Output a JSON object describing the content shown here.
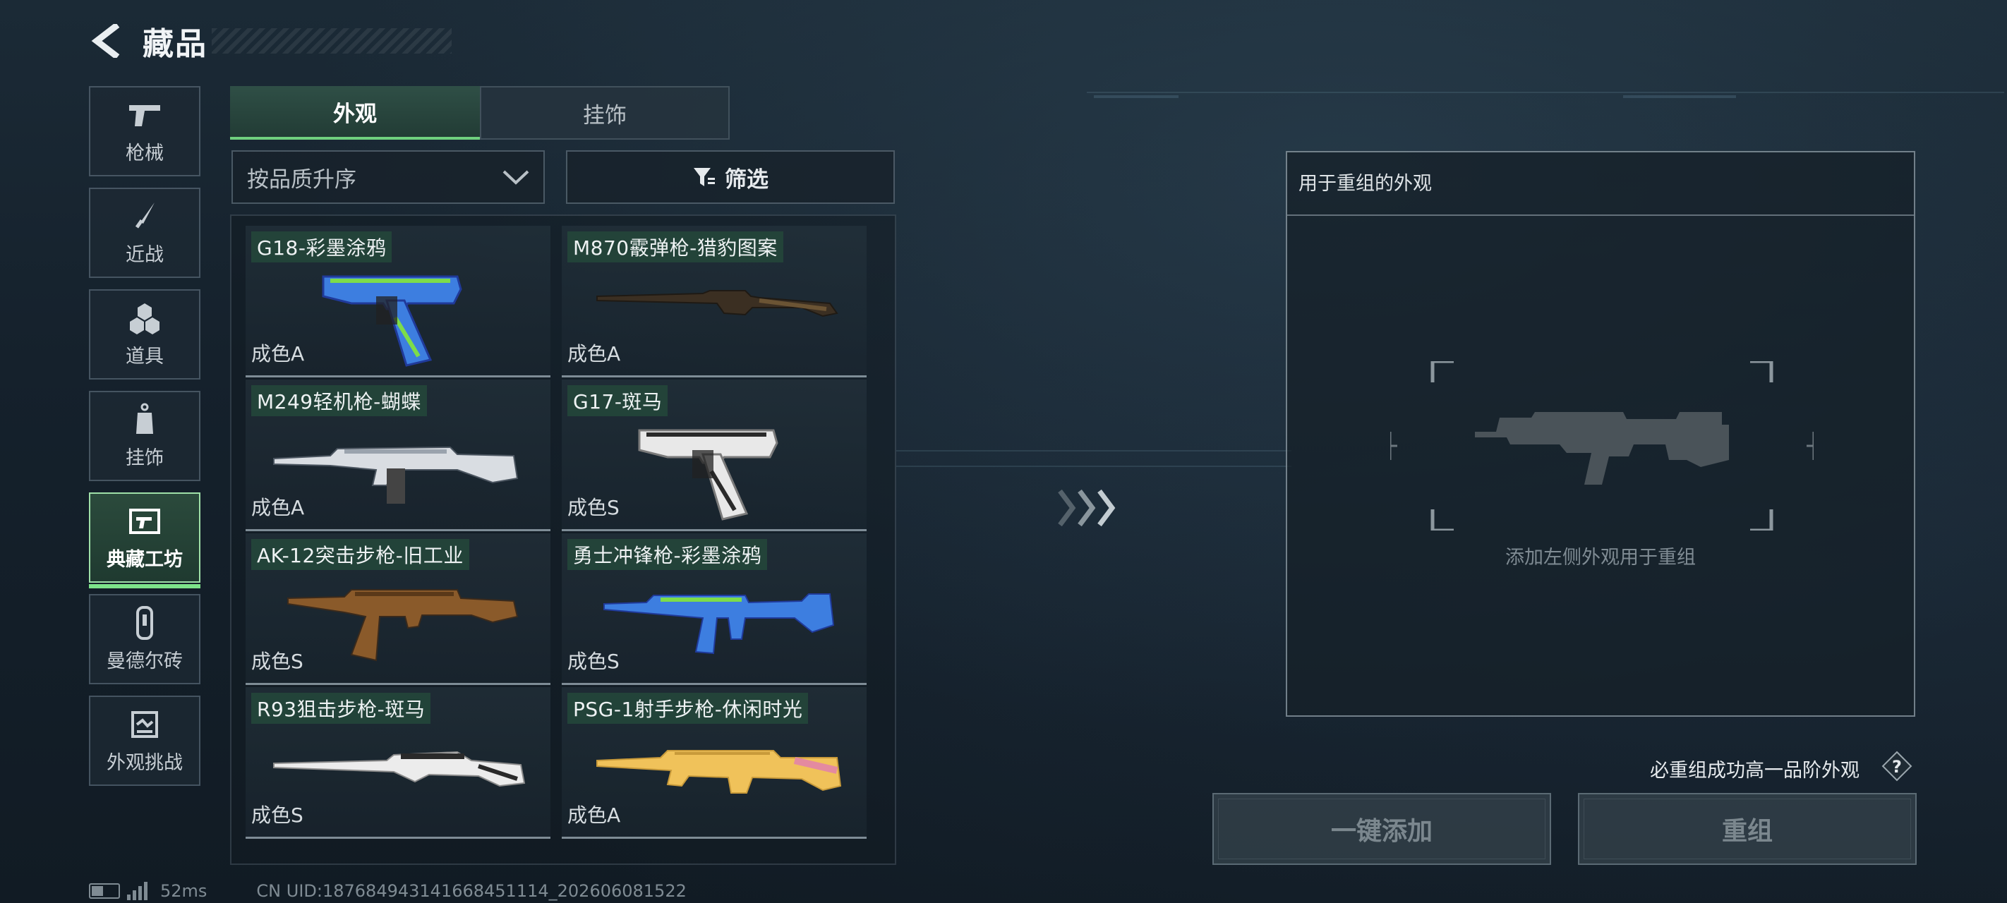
{
  "header": {
    "title": "藏品"
  },
  "nav": [
    {
      "label": "枪械",
      "icon": "pistol-icon",
      "active": false
    },
    {
      "label": "近战",
      "icon": "knife-icon",
      "active": false
    },
    {
      "label": "道具",
      "icon": "grenades-icon",
      "active": false
    },
    {
      "label": "挂饰",
      "icon": "charm-icon",
      "active": false
    },
    {
      "label": "典藏工坊",
      "icon": "workshop-icon",
      "active": true
    },
    {
      "label": "曼德尔砖",
      "icon": "mandel-brick-icon",
      "active": false
    },
    {
      "label": "外观挑战",
      "icon": "skin-challenge-icon",
      "active": false
    }
  ],
  "tabs": [
    {
      "label": "外观",
      "active": true
    },
    {
      "label": "挂饰",
      "active": false
    }
  ],
  "sort": {
    "label": "按品质升序"
  },
  "filter": {
    "label": "筛选"
  },
  "items": [
    {
      "name": "G18-彩墨涂鸦",
      "grade": "成色A",
      "weapon": "pistol",
      "colors": [
        "#3d7ee0",
        "#7ddc4a",
        "#203a9a"
      ]
    },
    {
      "name": "M870霰弹枪-猎豹图案",
      "grade": "成色A",
      "weapon": "shotgun",
      "colors": [
        "#3b2f22",
        "#6b5434",
        "#1f1a14"
      ]
    },
    {
      "name": "M249轻机枪-蝴蝶",
      "grade": "成色A",
      "weapon": "lmg",
      "colors": [
        "#d9dde2",
        "#9aa3ad",
        "#4b5560"
      ]
    },
    {
      "name": "G17-斑马",
      "grade": "成色S",
      "weapon": "pistol",
      "colors": [
        "#e8e8e8",
        "#2a2a2a",
        "#7a7a7a"
      ]
    },
    {
      "name": "AK-12突击步枪-旧工业",
      "grade": "成色S",
      "weapon": "rifle",
      "colors": [
        "#8a5a2a",
        "#5a3818",
        "#3a2a1c"
      ]
    },
    {
      "name": "勇士冲锋枪-彩墨涂鸦",
      "grade": "成色S",
      "weapon": "smg",
      "colors": [
        "#3d7ee0",
        "#7ddc4a",
        "#203a9a"
      ]
    },
    {
      "name": "R93狙击步枪-斑马",
      "grade": "成色S",
      "weapon": "sniper",
      "colors": [
        "#ececec",
        "#2a2a2a",
        "#8a8a8a"
      ]
    },
    {
      "name": "PSG-1射手步枪-休闲时光",
      "grade": "成色A",
      "weapon": "dmr",
      "colors": [
        "#f0c25a",
        "#e48aa0",
        "#c89a3a"
      ]
    }
  ],
  "target": {
    "title": "用于重组的外观",
    "hint": "添加左侧外观用于重组"
  },
  "note": "必重组成功高一品阶外观",
  "buttons": {
    "add_all": "一键添加",
    "recombine": "重组"
  },
  "status": {
    "ping": "52ms",
    "uid": "CN UID:187684943141668451114_202606081522"
  },
  "theme": {
    "accent": "#7de38a",
    "tab_active": "#2f4f46"
  }
}
